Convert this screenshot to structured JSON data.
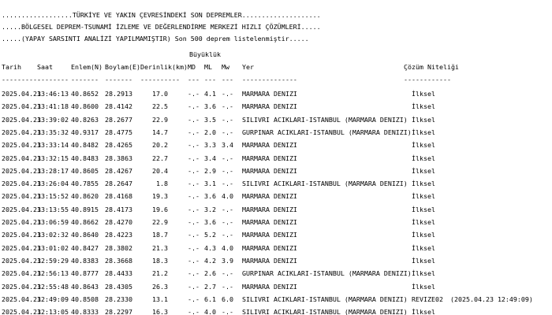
{
  "header": {
    "line1": "..................TÜRKİYE VE YAKIN ÇEVRESİNDEKİ SON DEPREMLER....................",
    "line2": ".....BÖLGESEL DEPREM-TSUNAMİ İZLEME VE DEĞERLENDİRME MERKEZİ HIZLI ÇÖZÜMLERİ.....",
    "line3": ".....(YAPAY SARSINTI ANALİZİ YAPILMAMIŞTIR) Son 500 deprem listelenmiştir....."
  },
  "columns": {
    "group_magnitude": "Büyüklük",
    "tarih": "Tarih",
    "saat": "Saat",
    "enlem": "Enlem(N)",
    "boylam": "Boylam(E)",
    "derinlik": "Derinlik(km)",
    "md": "MD",
    "ml": "ML",
    "mw": "Mw",
    "yer": "Yer",
    "cozum": "Çözüm Niteliği"
  },
  "separators": {
    "tarih": "----------",
    "saat": "--------",
    "enlem": "-------",
    "boylam": "-------",
    "derinlik": "----------",
    "md": "---",
    "ml": "---",
    "mw": "---",
    "yer": "--------------",
    "cozum": "------------"
  },
  "rows": [
    {
      "tarih": "2025.04.23",
      "saat": "13:46:13",
      "enlem": "40.8652",
      "boylam": "28.2913",
      "derinlik": "17.0",
      "md": "-.-",
      "ml": "4.1",
      "mw": "-.-",
      "yer": "MARMARA DENIZI",
      "cozum": "İlksel",
      "extra": ""
    },
    {
      "tarih": "2025.04.23",
      "saat": "13:41:18",
      "enlem": "40.8600",
      "boylam": "28.4142",
      "derinlik": "22.5",
      "md": "-.-",
      "ml": "3.6",
      "mw": "-.-",
      "yer": "MARMARA DENIZI",
      "cozum": "İlksel",
      "extra": ""
    },
    {
      "tarih": "2025.04.23",
      "saat": "13:39:02",
      "enlem": "40.8263",
      "boylam": "28.2677",
      "derinlik": "22.9",
      "md": "-.-",
      "ml": "3.5",
      "mw": "-.-",
      "yer": "SILIVRI ACIKLARI-ISTANBUL (MARMARA DENIZI)",
      "cozum": "İlksel",
      "extra": ""
    },
    {
      "tarih": "2025.04.23",
      "saat": "13:35:32",
      "enlem": "40.9317",
      "boylam": "28.4775",
      "derinlik": "14.7",
      "md": "-.-",
      "ml": "2.0",
      "mw": "-.-",
      "yer": "GURPINAR ACIKLARI-ISTANBUL (MARMARA DENIZI)",
      "cozum": "İlksel",
      "extra": ""
    },
    {
      "tarih": "2025.04.23",
      "saat": "13:33:14",
      "enlem": "40.8482",
      "boylam": "28.4265",
      "derinlik": "20.2",
      "md": "-.-",
      "ml": "3.3",
      "mw": "3.4",
      "yer": "MARMARA DENIZI",
      "cozum": "İlksel",
      "extra": ""
    },
    {
      "tarih": "2025.04.23",
      "saat": "13:32:15",
      "enlem": "40.8483",
      "boylam": "28.3863",
      "derinlik": "22.7",
      "md": "-.-",
      "ml": "3.4",
      "mw": "-.-",
      "yer": "MARMARA DENIZI",
      "cozum": "İlksel",
      "extra": ""
    },
    {
      "tarih": "2025.04.23",
      "saat": "13:28:17",
      "enlem": "40.8605",
      "boylam": "28.4267",
      "derinlik": "20.4",
      "md": "-.-",
      "ml": "2.9",
      "mw": "-.-",
      "yer": "MARMARA DENIZI",
      "cozum": "İlksel",
      "extra": ""
    },
    {
      "tarih": "2025.04.23",
      "saat": "13:26:04",
      "enlem": "40.7855",
      "boylam": "28.2647",
      "derinlik": "1.8",
      "md": "-.-",
      "ml": "3.1",
      "mw": "-.-",
      "yer": "SILIVRI ACIKLARI-ISTANBUL (MARMARA DENIZI)",
      "cozum": "İlksel",
      "extra": ""
    },
    {
      "tarih": "2025.04.23",
      "saat": "13:15:52",
      "enlem": "40.8620",
      "boylam": "28.4168",
      "derinlik": "19.3",
      "md": "-.-",
      "ml": "3.6",
      "mw": "4.0",
      "yer": "MARMARA DENIZI",
      "cozum": "İlksel",
      "extra": ""
    },
    {
      "tarih": "2025.04.23",
      "saat": "13:13:55",
      "enlem": "40.8915",
      "boylam": "28.4173",
      "derinlik": "19.6",
      "md": "-.-",
      "ml": "3.2",
      "mw": "-.-",
      "yer": "MARMARA DENIZI",
      "cozum": "İlksel",
      "extra": ""
    },
    {
      "tarih": "2025.04.23",
      "saat": "13:06:59",
      "enlem": "40.8662",
      "boylam": "28.4270",
      "derinlik": "22.9",
      "md": "-.-",
      "ml": "3.6",
      "mw": "-.-",
      "yer": "MARMARA DENIZI",
      "cozum": "İlksel",
      "extra": ""
    },
    {
      "tarih": "2025.04.23",
      "saat": "13:02:32",
      "enlem": "40.8640",
      "boylam": "28.4223",
      "derinlik": "18.7",
      "md": "-.-",
      "ml": "5.2",
      "mw": "-.-",
      "yer": "MARMARA DENIZI",
      "cozum": "İlksel",
      "extra": ""
    },
    {
      "tarih": "2025.04.23",
      "saat": "13:01:02",
      "enlem": "40.8427",
      "boylam": "28.3802",
      "derinlik": "21.3",
      "md": "-.-",
      "ml": "4.3",
      "mw": "4.0",
      "yer": "MARMARA DENIZI",
      "cozum": "İlksel",
      "extra": ""
    },
    {
      "tarih": "2025.04.23",
      "saat": "12:59:29",
      "enlem": "40.8383",
      "boylam": "28.3668",
      "derinlik": "18.3",
      "md": "-.-",
      "ml": "4.2",
      "mw": "3.9",
      "yer": "MARMARA DENIZI",
      "cozum": "İlksel",
      "extra": ""
    },
    {
      "tarih": "2025.04.23",
      "saat": "12:56:13",
      "enlem": "40.8777",
      "boylam": "28.4433",
      "derinlik": "21.2",
      "md": "-.-",
      "ml": "2.6",
      "mw": "-.-",
      "yer": "GURPINAR ACIKLARI-ISTANBUL (MARMARA DENIZI)",
      "cozum": "İlksel",
      "extra": ""
    },
    {
      "tarih": "2025.04.23",
      "saat": "12:55:48",
      "enlem": "40.8643",
      "boylam": "28.4305",
      "derinlik": "26.3",
      "md": "-.-",
      "ml": "2.7",
      "mw": "-.-",
      "yer": "MARMARA DENIZI",
      "cozum": "İlksel",
      "extra": ""
    },
    {
      "tarih": "2025.04.23",
      "saat": "12:49:09",
      "enlem": "40.8508",
      "boylam": "28.2330",
      "derinlik": "13.1",
      "md": "-.-",
      "ml": "6.1",
      "mw": "6.0",
      "yer": "SILIVRI ACIKLARI-ISTANBUL (MARMARA DENIZI)",
      "cozum": "REVIZE02",
      "extra": "(2025.04.23 12:49:09)"
    },
    {
      "tarih": "2025.04.23",
      "saat": "12:13:05",
      "enlem": "40.8333",
      "boylam": "28.2297",
      "derinlik": "16.3",
      "md": "-.-",
      "ml": "4.0",
      "mw": "-.-",
      "yer": "SILIVRI ACIKLARI-ISTANBUL (MARMARA DENIZI)",
      "cozum": "İlksel",
      "extra": ""
    }
  ]
}
